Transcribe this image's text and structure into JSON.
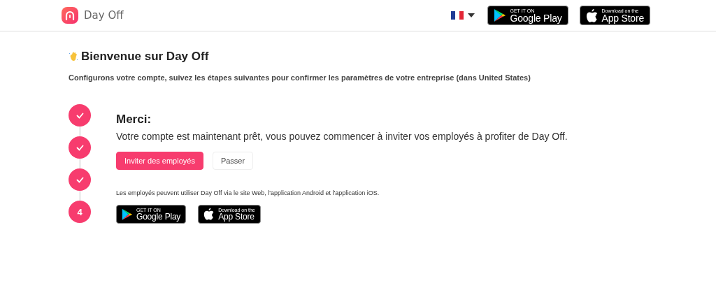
{
  "header": {
    "brand": "Day Off",
    "stores": [
      {
        "kind": "google",
        "line1": "GET IT ON",
        "line2": "Google Play"
      },
      {
        "kind": "apple",
        "line1": "Download on the",
        "line2": "App Store"
      }
    ]
  },
  "intro": {
    "title": "Bienvenue sur Day Off",
    "subtitle": "Configurons votre compte, suivez les étapes suivantes pour confirmer les paramètres de votre entreprise (dans United States)"
  },
  "steps": [
    {
      "done": true
    },
    {
      "done": true
    },
    {
      "done": true
    },
    {
      "done": false,
      "label": "4"
    }
  ],
  "panel": {
    "heading": "Merci:",
    "message": "Votre compte est maintenant prêt, vous pouvez commencer à inviter vos employés à profiter de Day Off.",
    "buttons": [
      {
        "kind": "primary",
        "label": "Inviter des employés"
      },
      {
        "kind": "secondary",
        "label": "Passer"
      }
    ],
    "note": "Les employés peuvent utiliser Day Off via le site Web, l'application Android et l'application iOS.",
    "stores": [
      {
        "kind": "google",
        "line1": "GET IT ON",
        "line2": "Google Play"
      },
      {
        "kind": "apple",
        "line1": "Download on the",
        "line2": "App Store"
      }
    ]
  }
}
